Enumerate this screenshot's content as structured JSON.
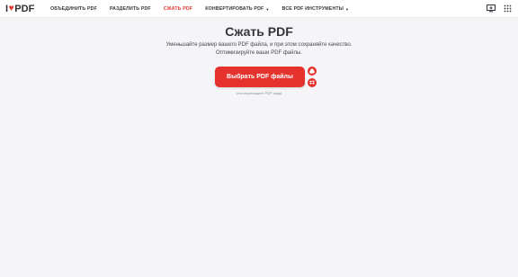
{
  "logo": {
    "text_left": "I",
    "text_right": "PDF"
  },
  "nav": {
    "items": [
      {
        "label": "Объединить PDF",
        "active": false,
        "dropdown": false
      },
      {
        "label": "Разделить PDF",
        "active": false,
        "dropdown": false
      },
      {
        "label": "Сжать PDF",
        "active": true,
        "dropdown": false
      },
      {
        "label": "Конвертировать PDF",
        "active": false,
        "dropdown": true
      },
      {
        "label": "Все PDF инструменты",
        "active": false,
        "dropdown": true
      }
    ]
  },
  "main": {
    "title": "Сжать PDF",
    "subtitle_line1": "Уменьшайте размер вашего PDF файла, и при этом сохраняйте качество.",
    "subtitle_line2": "Оптимизируйте ваши PDF файлы.",
    "select_button": "Выбрать PDF файлы",
    "drop_hint": "или перетащите PDF сюда"
  },
  "icons": {
    "desktop_app": "desktop-download-icon",
    "menu": "grid-menu-icon",
    "google_drive": "google-drive-icon",
    "dropbox": "dropbox-icon"
  },
  "colors": {
    "accent": "#e5322d",
    "text": "#33333b",
    "background": "#f5f5f7"
  }
}
